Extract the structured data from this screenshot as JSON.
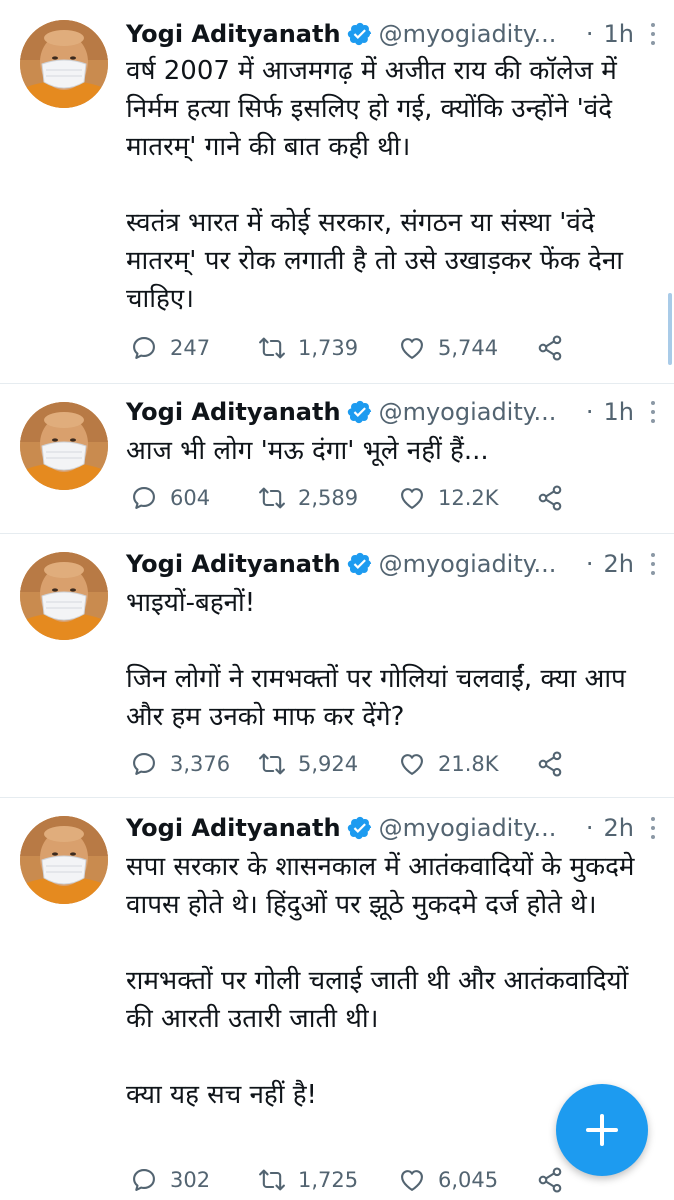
{
  "colors": {
    "accent": "#1d9bf0",
    "text": "#0f1419",
    "secondary_text": "#536471",
    "divider": "#e6ecf0"
  },
  "tweets": [
    {
      "author_name": "Yogi Adityanath",
      "author_handle": "@myogiadity...",
      "separator": "·",
      "time": "1h",
      "text": "वर्ष 2007 में आजमगढ़ में अजीत राय की कॉलेज में निर्मम हत्या सिर्फ इसलिए हो गई, क्योंकि उन्होंने 'वंदे मातरम्' गाने की बात कही थी।\n\nस्वतंत्र भारत में कोई सरकार, संगठन या संस्था 'वंदे मातरम्' पर रोक लगाती है तो उसे उखाड़कर फेंक देना चाहिए।",
      "replies": "247",
      "retweets": "1,739",
      "likes": "5,744"
    },
    {
      "author_name": "Yogi Adityanath",
      "author_handle": "@myogiadity...",
      "separator": "·",
      "time": "1h",
      "text": "आज भी लोग 'मऊ दंगा' भूले नहीं हैं...",
      "replies": "604",
      "retweets": "2,589",
      "likes": "12.2K"
    },
    {
      "author_name": "Yogi Adityanath",
      "author_handle": "@myogiadity...",
      "separator": "·",
      "time": "2h",
      "text": "भाइयों-बहनों!\n\nजिन लोगों ने रामभक्तों पर गोलियां चलवाईं, क्या आप और हम उनको माफ कर देंगे?",
      "replies": "3,376",
      "retweets": "5,924",
      "likes": "21.8K"
    },
    {
      "author_name": "Yogi Adityanath",
      "author_handle": "@myogiadity...",
      "separator": "·",
      "time": "2h",
      "text": "सपा सरकार के शासनकाल में आतंकवादियों के मुकदमे वापस होते थे। हिंदुओं पर झूठे मुकदमे दर्ज होते थे।\n\nरामभक्तों पर गोली चलाई जाती थी और आतंकवादियों की आरती उतारी जाती थी।\n\nक्या यह सच नहीं है!",
      "replies": "302",
      "retweets": "1,725",
      "likes": "6,045"
    }
  ],
  "icons": {
    "verified": "verified-badge-icon",
    "reply": "reply-icon",
    "retweet": "retweet-icon",
    "like": "heart-icon",
    "share": "share-icon",
    "compose": "plus-icon"
  }
}
